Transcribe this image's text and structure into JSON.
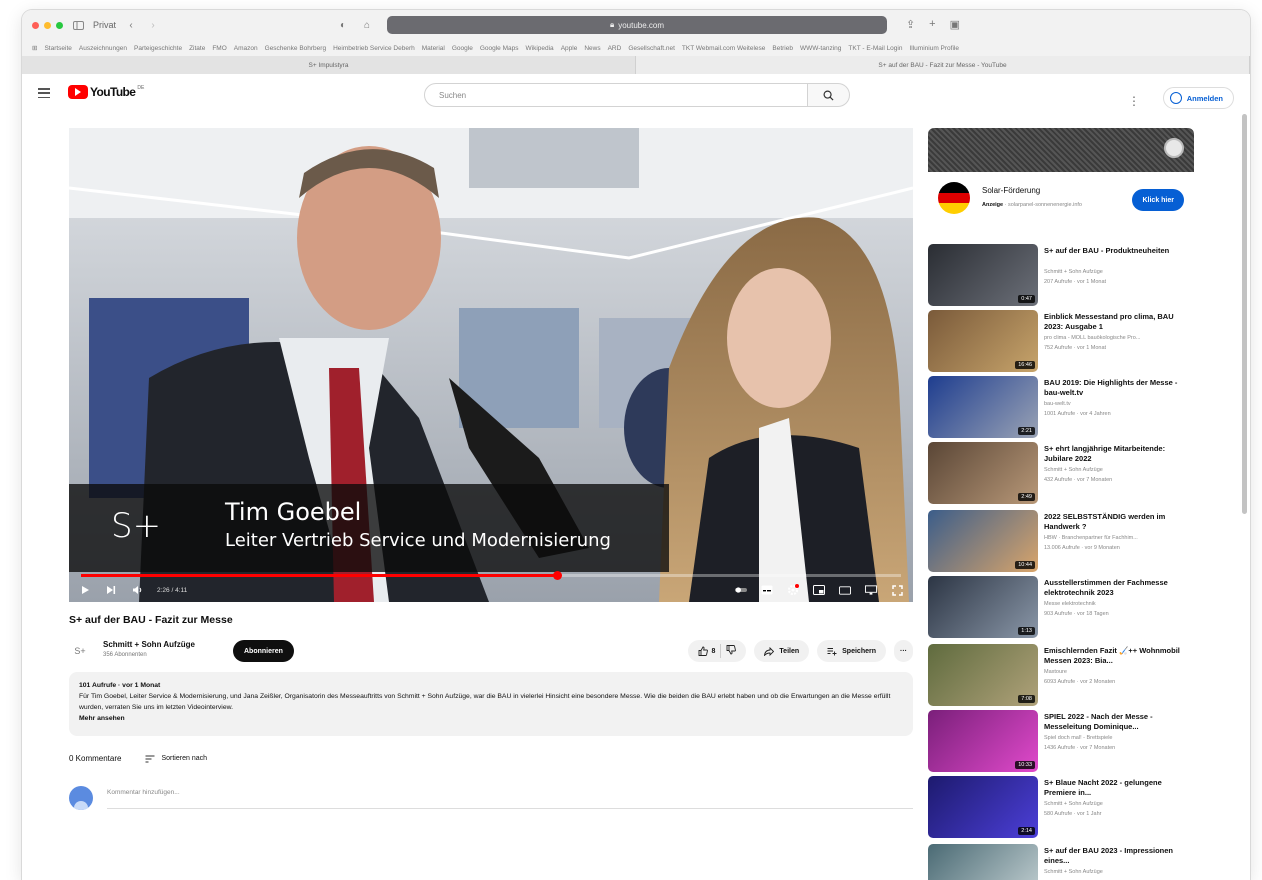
{
  "browser": {
    "sidebar_label": "Privat",
    "url": "youtube.com",
    "favorites": [
      "Startseite",
      "Auszeichnungen",
      "Parteigeschichte",
      "Zitate",
      "FMO",
      "Amazon",
      "Geschenke Bohrberg",
      "Heimbetrieb Service Deberh",
      "Material",
      "Google",
      "Google Maps",
      "Wikipedia",
      "Apple",
      "News",
      "ARD",
      "Gesellschaft.net",
      "TKT Webmail.com Weitelese",
      "Betrieb",
      "WWW-tanzing",
      "TKT - E-Mail Login",
      "Illuminium Profile"
    ],
    "tabs": [
      {
        "label": "S+ Impulstyra",
        "active": false
      },
      {
        "label": "S+ auf der BAU - Fazit zur Messe - YouTube",
        "active": true
      }
    ]
  },
  "header": {
    "logo_text": "YouTube",
    "logo_suffix": "DE",
    "search_placeholder": "Suchen",
    "signin_label": "Anmelden"
  },
  "player": {
    "overlay_logo": "S+",
    "overlay_name": "Tim Goebel",
    "overlay_role": "Leiter Vertrieb Service und Modernisierung",
    "time": "2:26 / 4:11",
    "progress_fraction": 0.58
  },
  "video": {
    "title": "S+ auf der BAU - Fazit zur Messe",
    "channel_logo": "S+",
    "channel": "Schmitt + Sohn Aufzüge",
    "subscribers": "356 Abonnenten",
    "subscribe_label": "Abonnieren",
    "likes": "8",
    "share_label": "Teilen",
    "save_label": "Speichern",
    "more_label": "···"
  },
  "description": {
    "meta": "101 Aufrufe · vor 1 Monat",
    "text": "Für Tim Goebel, Leiter Service & Modernisierung, und Jana Zeißler, Organisatorin des Messeauftritts von Schmitt + Sohn Aufzüge, war die BAU in vielerlei Hinsicht eine besondere Messe. Wie die beiden die BAU erlebt haben und ob die Erwartungen an die Messe erfüllt wurden, verraten Sie uns im letzten Videointerview.",
    "more": "Mehr ansehen"
  },
  "comments": {
    "count_label": "0 Kommentare",
    "sort_label": "Sortieren nach",
    "placeholder": "Kommentar hinzufügen..."
  },
  "ad": {
    "title": "Solar-Förderung",
    "badge": "Anzeige",
    "subtitle": "· solarpanel-sonnenenergie.info",
    "button": "Klick hier",
    "flag_colors": [
      "#000000",
      "#dd0000",
      "#ffce00"
    ]
  },
  "recommendations": [
    {
      "title": "S+ auf der BAU - Produktneuheiten",
      "channel": "Schmitt + Sohn Aufzüge",
      "meta": "207 Aufrufe · vor 1 Monat",
      "duration": "0:47",
      "colors": [
        "#2a2d33",
        "#6c7079"
      ]
    },
    {
      "title": "Einblick Messestand pro clima, BAU 2023: Ausgabe 1",
      "channel": "pro clima - MOLL bauökologische Pro...",
      "meta": "752 Aufrufe · vor 1 Monat",
      "duration": "16:46",
      "colors": [
        "#7a5a3a",
        "#c7a46b"
      ]
    },
    {
      "title": "BAU 2019: Die Highlights der Messe - bau-welt.tv",
      "channel": "bau-welt.tv",
      "meta": "1001 Aufrufe · vor 4 Jahren",
      "duration": "2:21",
      "colors": [
        "#1e3d8f",
        "#9aa3b5"
      ]
    },
    {
      "title": "S+ ehrt langjährige Mitarbeitende: Jubilare 2022",
      "channel": "Schmitt + Sohn Aufzüge",
      "meta": "432 Aufrufe · vor 7 Monaten",
      "duration": "2:49",
      "colors": [
        "#5a4636",
        "#b89878"
      ]
    },
    {
      "title": "2022 SELBSTSTÄNDIG werden im Handwerk ?",
      "channel": "HBW · Branchenpartner für Fachhim...",
      "meta": "13.006 Aufrufe · vor 9 Monaten",
      "duration": "10:44",
      "colors": [
        "#3b5d8a",
        "#d9a56b"
      ]
    },
    {
      "title": "Ausstellerstimmen der Fachmesse elektrotechnik 2023",
      "channel": "Messe elektrotechnik",
      "meta": "903 Aufrufe · vor 18 Tagen",
      "duration": "1:13",
      "colors": [
        "#2c3544",
        "#8a97a8"
      ]
    },
    {
      "title": "Emischlernden Fazit 🏑++ Wohnmobil Messen 2023: Bia...",
      "channel": "Maxtoure",
      "meta": "6093 Aufrufe · vor 2 Monaten",
      "duration": "7:08",
      "colors": [
        "#5f6b3e",
        "#b0a27a"
      ]
    },
    {
      "title": "SPIEL 2022 - Nach der Messe - Messeleitung Dominique...",
      "channel": "Spiel doch mal! - Brettspiele",
      "meta": "1436 Aufrufe · vor 7 Monaten",
      "duration": "10:33",
      "colors": [
        "#7a1f7a",
        "#e04acb"
      ]
    },
    {
      "title": "S+ Blaue Nacht 2022 - gelungene Premiere in...",
      "channel": "Schmitt + Sohn Aufzüge",
      "meta": "580 Aufrufe · vor 1 Jahr",
      "duration": "2:14",
      "colors": [
        "#1d1a6e",
        "#4c3fd8"
      ]
    },
    {
      "title": "S+ auf der BAU 2023 - Impressionen eines...",
      "channel": "Schmitt + Sohn Aufzüge",
      "meta": "",
      "duration": "",
      "colors": [
        "#4a6a74",
        "#c8d4d6"
      ]
    }
  ]
}
